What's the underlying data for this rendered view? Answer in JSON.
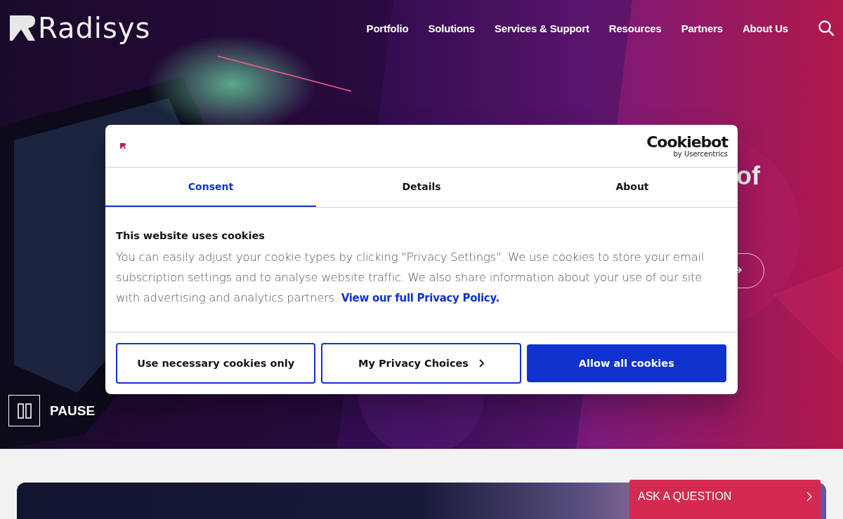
{
  "header": {
    "logo": "Radisys",
    "nav": [
      {
        "label": "Portfolio"
      },
      {
        "label": "Solutions"
      },
      {
        "label": "Services & Support"
      },
      {
        "label": "Resources"
      },
      {
        "label": "Partners"
      },
      {
        "label": "About Us"
      }
    ]
  },
  "hero": {
    "heading_fragment": "of",
    "pause_label": "PAUSE"
  },
  "cookie_dialog": {
    "provider": "Cookiebot",
    "provider_sub": "by Usercentrics",
    "tabs": [
      {
        "label": "Consent",
        "selected": true
      },
      {
        "label": "Details",
        "selected": false
      },
      {
        "label": "About",
        "selected": false
      }
    ],
    "title": "This website uses cookies",
    "body": "You can easily adjust your cookie types by clicking \"Privacy Settings\". We use cookies to store your email subscription settings and to analyse website traffic. We also share information about your use of our site with advertising and analytics partners.",
    "link": "View our full Privacy Policy.",
    "buttons": [
      {
        "label": "Use necessary cookies only",
        "kind": "outline"
      },
      {
        "label": "My Privacy Choices",
        "kind": "chevron"
      },
      {
        "label": "Allow all cookies",
        "kind": "primary"
      }
    ]
  },
  "ask_button": "ASK A QUESTION"
}
